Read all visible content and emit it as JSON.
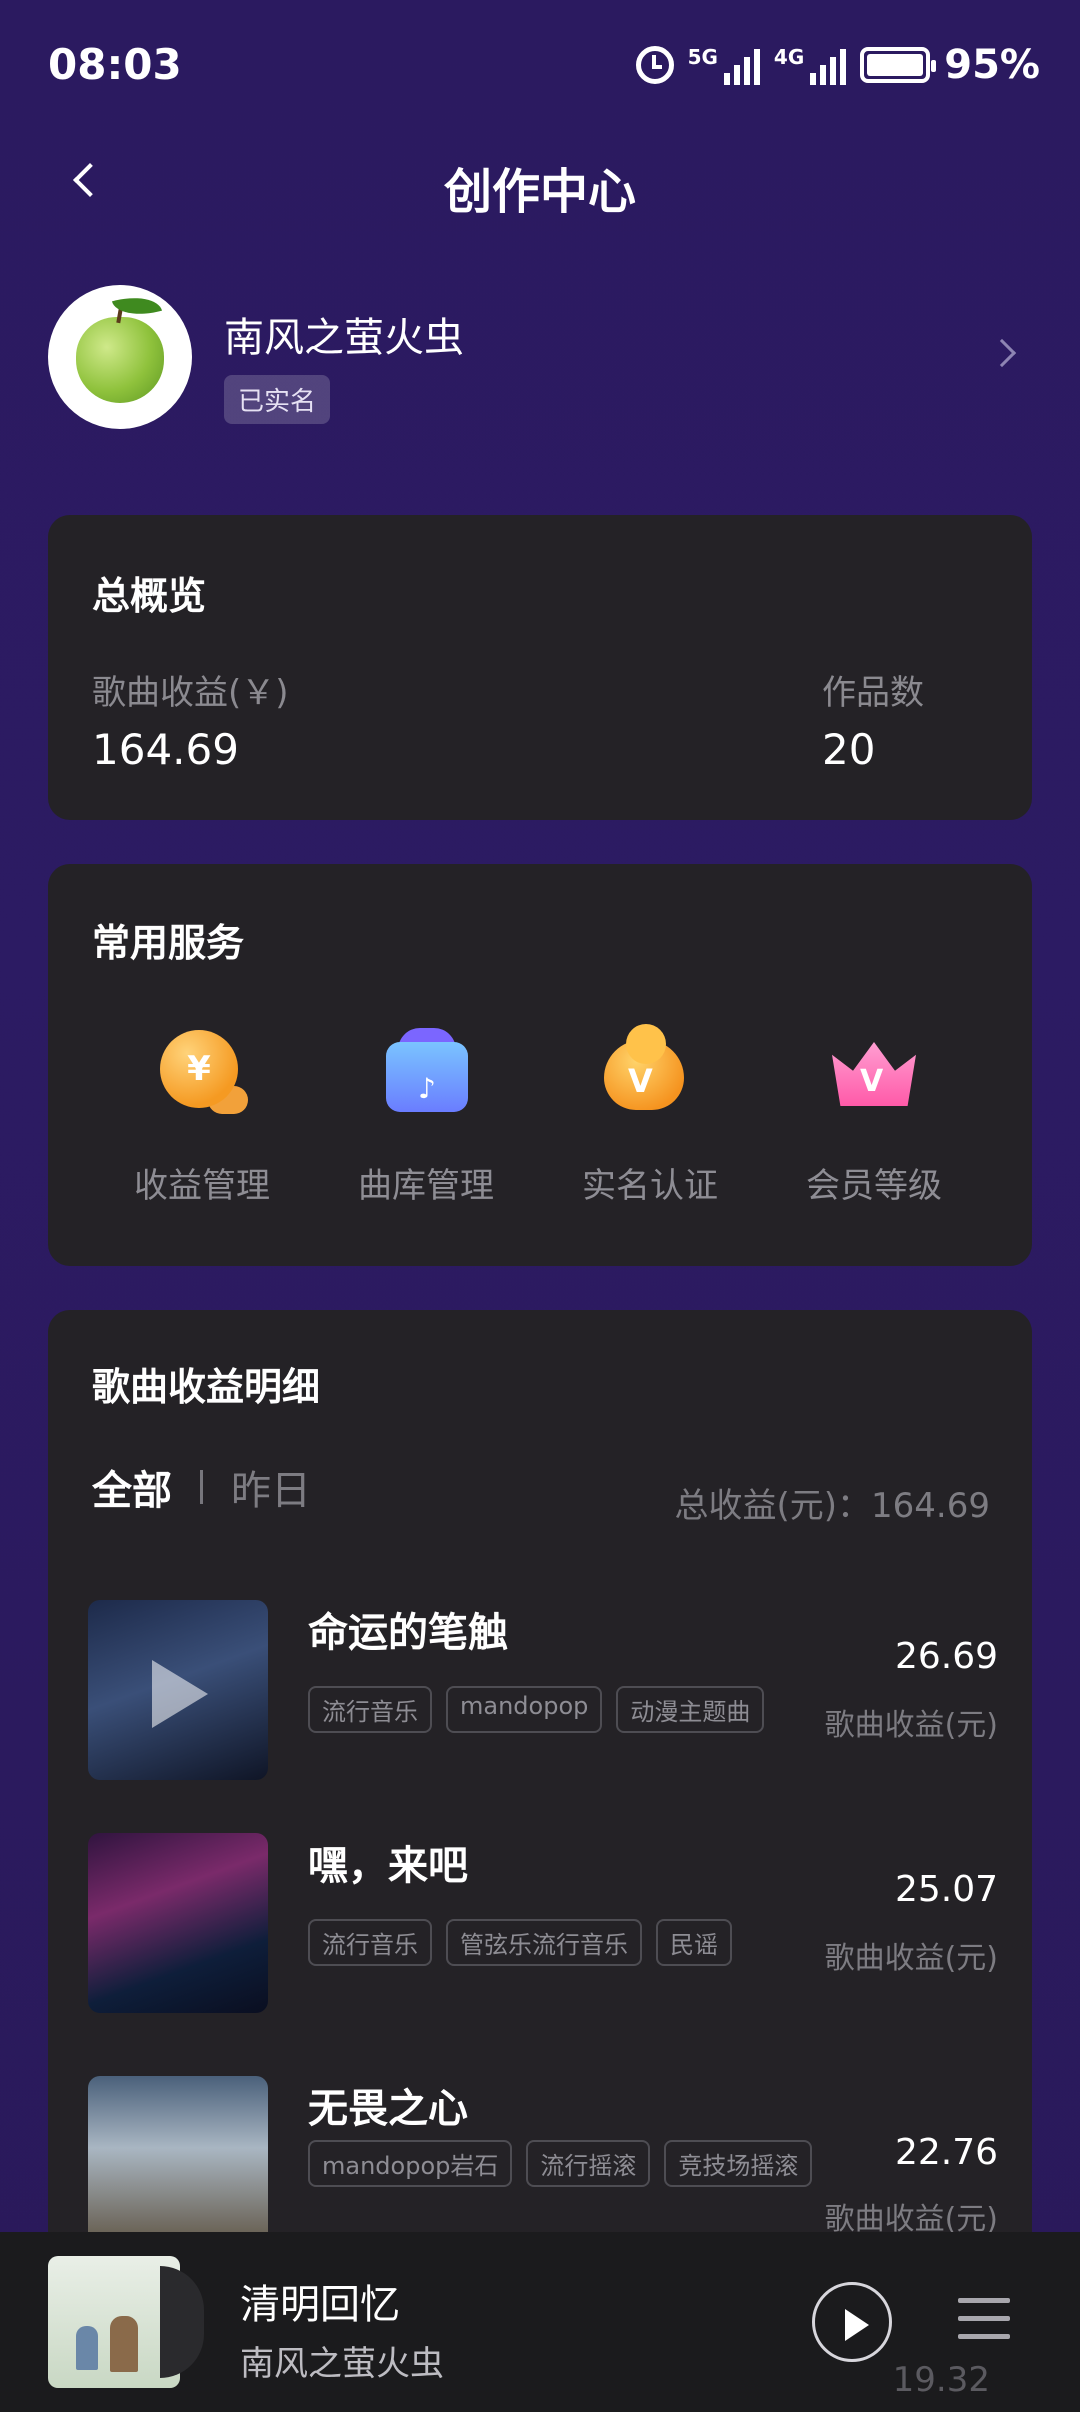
{
  "status_bar": {
    "time": "08:03",
    "net1": "5G",
    "net2": "4G",
    "battery": "95%"
  },
  "header": {
    "title": "创作中心"
  },
  "profile": {
    "name": "南风之萤火虫",
    "badge": "已实名"
  },
  "overview": {
    "title": "总概览",
    "earnings_label": "歌曲收益(￥)",
    "earnings_value": "164.69",
    "works_label": "作品数",
    "works_value": "20"
  },
  "services": {
    "title": "常用服务",
    "items": [
      {
        "label": "收益管理",
        "icon": "coin-icon"
      },
      {
        "label": "曲库管理",
        "icon": "music-library-icon"
      },
      {
        "label": "实名认证",
        "icon": "verify-icon"
      },
      {
        "label": "会员等级",
        "icon": "crown-icon"
      }
    ]
  },
  "details": {
    "title": "歌曲收益明细",
    "tab_all": "全部",
    "tab_yesterday": "昨日",
    "total_label": "总收益(元)：164.69",
    "earn_label": "歌曲收益(元)",
    "songs": [
      {
        "title": "命运的笔触",
        "tags": [
          "流行音乐",
          "mandopop",
          "动漫主题曲"
        ],
        "earnings": "26.69"
      },
      {
        "title": "嘿，来吧",
        "tags": [
          "流行音乐",
          "管弦乐流行音乐",
          "民谣"
        ],
        "earnings": "25.07"
      },
      {
        "title": "无畏之心",
        "tags": [
          "mandopop岩石",
          "流行摇滚",
          "竞技场摇滚"
        ],
        "earnings": "22.76"
      }
    ],
    "peek_earnings": "19.32"
  },
  "player": {
    "title": "清明回忆",
    "artist": "南风之萤火虫"
  }
}
